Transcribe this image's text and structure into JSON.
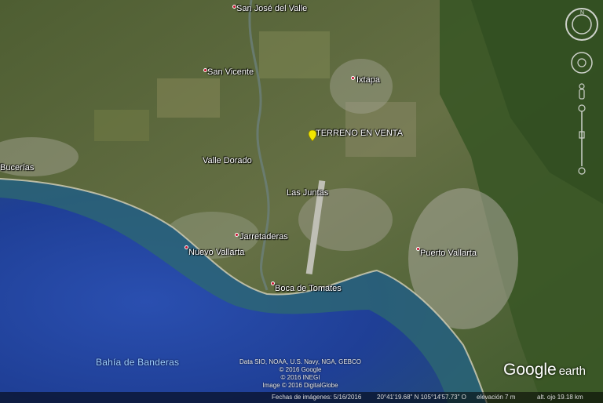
{
  "places": [
    {
      "name": "San José del Valle",
      "key": "san_jose"
    },
    {
      "name": "San Vicente",
      "key": "san_vicente"
    },
    {
      "name": "Ixtapa",
      "key": "ixtapa"
    },
    {
      "name": "TERRENO EN VENTA",
      "key": "terreno"
    },
    {
      "name": "Bucerías",
      "key": "bucerias"
    },
    {
      "name": "Valle Dorado",
      "key": "valle_dorado"
    },
    {
      "name": "Las Juntas",
      "key": "las_juntas"
    },
    {
      "name": "Jarretaderas",
      "key": "jarretaderas"
    },
    {
      "name": "Nuevo Vallarta",
      "key": "nuevo_vallarta"
    },
    {
      "name": "Puerto Vallarta",
      "key": "puerto_vallarta"
    },
    {
      "name": "Boca de Tomates",
      "key": "boca_tomates"
    }
  ],
  "bay_label": "Bahía de Banderas",
  "credits": {
    "line1": "Data SIO, NOAA, U.S. Navy, NGA, GEBCO",
    "line2": "© 2016 Google",
    "line3": "© 2016 INEGI",
    "line4": "Image © 2016 DigitalGlobe"
  },
  "status": {
    "imagery_date": "Fechas de imágenes: 5/16/2016",
    "coordinates": "20°41'19.68\" N  105°14'57.73\" O",
    "elevation": "elevación   7 m",
    "eye_alt": "alt. ojo  19.18 km"
  },
  "logo": {
    "google": "Google",
    "earth": "earth"
  },
  "colors": {
    "ocean_deep": "#1e3a8a",
    "ocean_shallow": "#2f6f74",
    "land": "#5a6b3a",
    "urban": "#a9a89a",
    "marker": "#f2e600",
    "pin": "#c8102e"
  }
}
